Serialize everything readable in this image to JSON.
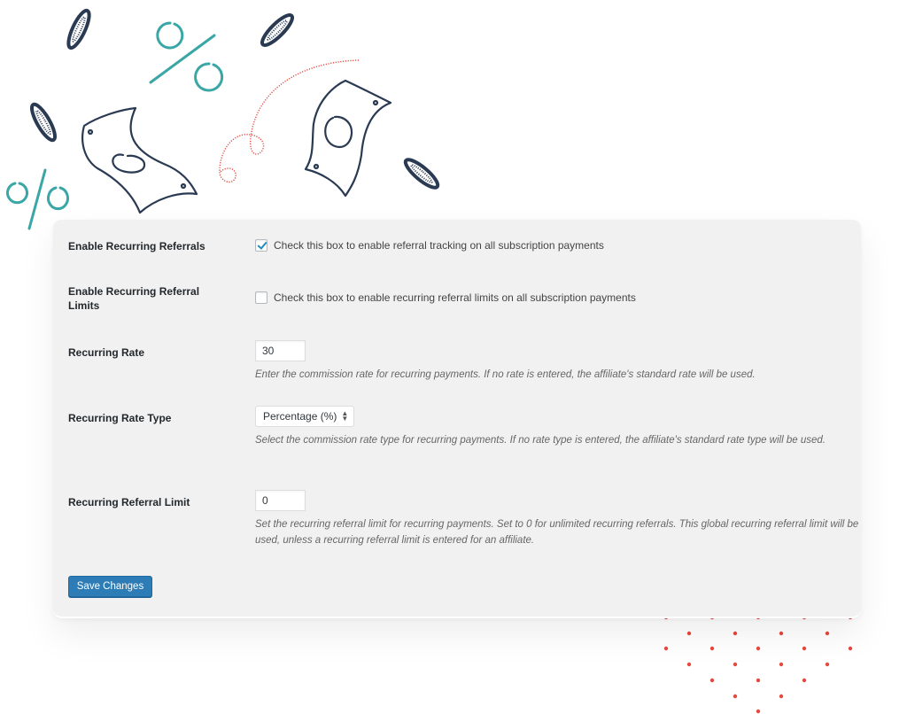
{
  "colors": {
    "accent_teal": "#3aa6a6",
    "ink_navy": "#2a3a52",
    "dot_red": "#e8473f",
    "button_blue": "#2e7cb5"
  },
  "settings": {
    "enable_recurring": {
      "label": "Enable Recurring Referrals",
      "checked": true,
      "description": "Check this box to enable referral tracking on all subscription payments"
    },
    "enable_limits": {
      "label": "Enable Recurring Referral Limits",
      "checked": false,
      "description": "Check this box to enable recurring referral limits on all subscription payments"
    },
    "recurring_rate": {
      "label": "Recurring Rate",
      "value": "30",
      "description": "Enter the commission rate for recurring payments. If no rate is entered, the affiliate's standard rate will be used."
    },
    "rate_type": {
      "label": "Recurring Rate Type",
      "selected": "Percentage (%)",
      "description": "Select the commission rate type for recurring payments. If no rate type is entered, the affiliate's standard rate type will be used."
    },
    "referral_limit": {
      "label": "Recurring Referral Limit",
      "value": "0",
      "description": "Set the recurring referral limit for recurring payments. Set to 0 for unlimited recurring referrals. This global recurring referral limit will be used, unless a recurring referral limit is entered for an affiliate."
    }
  },
  "actions": {
    "save_label": "Save Changes"
  },
  "decorations": [
    "coin-icon",
    "percent-icon",
    "banknote-icon",
    "dotted-path",
    "dot-grid"
  ]
}
